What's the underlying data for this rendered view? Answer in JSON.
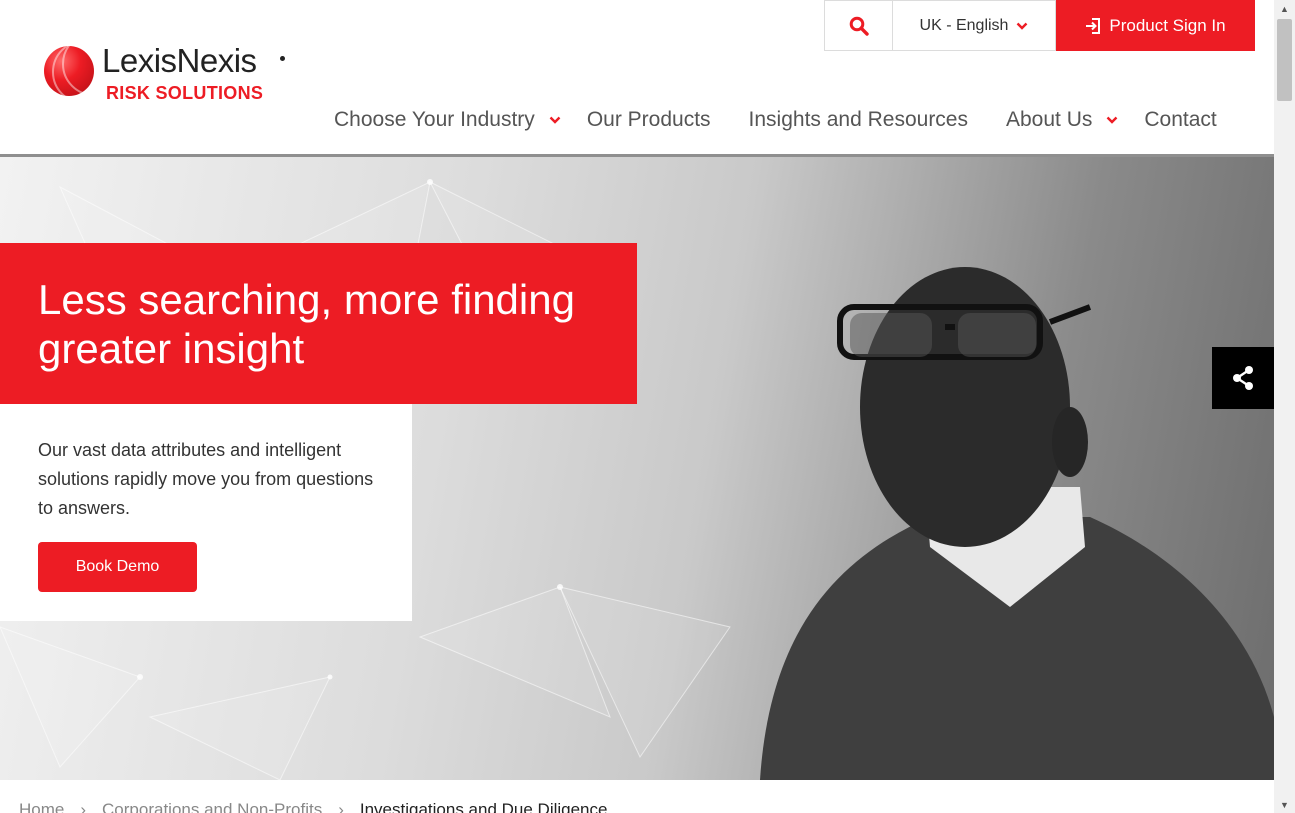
{
  "brand": {
    "name": "LexisNexis",
    "sub": "RISK SOLUTIONS",
    "accent": "#ed1c24"
  },
  "utility": {
    "search_icon": "search-icon",
    "language": "UK - English",
    "sign_in": "Product Sign In"
  },
  "nav": {
    "items": [
      {
        "label": "Choose Your Industry",
        "has_dropdown": true
      },
      {
        "label": "Our Products",
        "has_dropdown": false
      },
      {
        "label": "Insights and Resources",
        "has_dropdown": false
      },
      {
        "label": "About Us",
        "has_dropdown": true
      },
      {
        "label": "Contact",
        "has_dropdown": false
      }
    ]
  },
  "hero": {
    "headline": "Less searching, more finding greater insight",
    "intro": "Our vast data attributes and intelligent solutions rapidly move you from questions to answers.",
    "cta": "Book Demo"
  },
  "share": {
    "icon": "share-icon"
  },
  "breadcrumb": {
    "items": [
      "Home",
      "Corporations and Non-Profits",
      "Investigations and Due Diligence"
    ]
  }
}
